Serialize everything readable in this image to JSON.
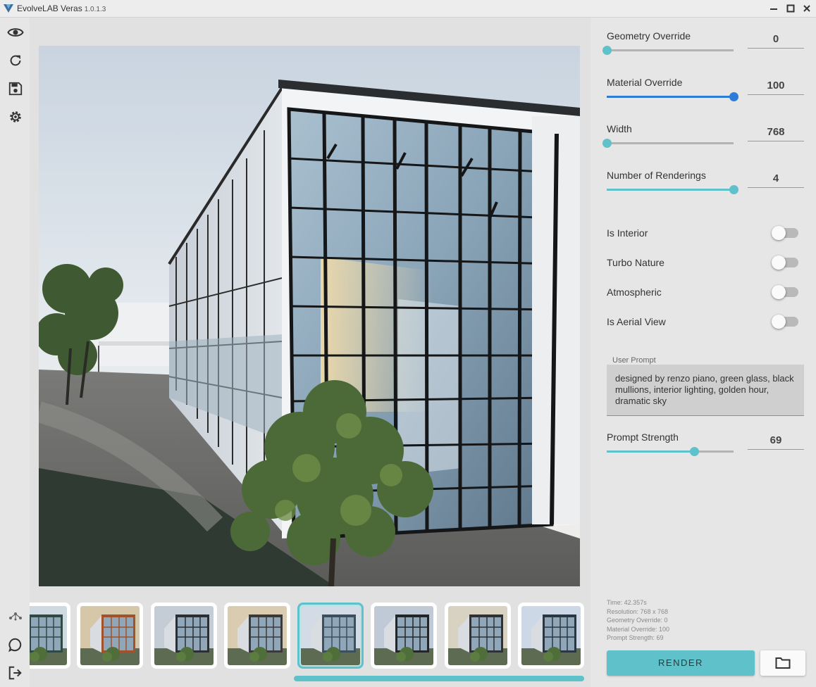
{
  "window": {
    "title": "EvolveLAB Veras",
    "version": "1.0.1.3"
  },
  "colors": {
    "accent": "#5fc1c9",
    "blue_slider": "#2f7bd8",
    "track": "#b3b3b3"
  },
  "sidebar": {
    "top_icons": [
      "eye-icon",
      "refresh-icon",
      "save-icon",
      "gear-icon"
    ],
    "bottom_icons": [
      "share-icon",
      "chat-icon",
      "logout-icon"
    ]
  },
  "sliders": [
    {
      "label": "Geometry Override",
      "value": "0",
      "fraction": 0.0,
      "color": "#5fc1c9"
    },
    {
      "label": "Material Override",
      "value": "100",
      "fraction": 1.0,
      "color": "#2f7bd8"
    },
    {
      "label": "Width",
      "value": "768",
      "fraction": 0.0,
      "color": "#5fc1c9"
    },
    {
      "label": "Number of Renderings",
      "value": "4",
      "fraction": 1.0,
      "color": "#5fc1c9"
    }
  ],
  "toggles": [
    {
      "label": "Is Interior",
      "on": false
    },
    {
      "label": "Turbo Nature",
      "on": false
    },
    {
      "label": "Atmospheric",
      "on": false
    },
    {
      "label": "Is Aerial View",
      "on": false
    }
  ],
  "prompt": {
    "caption": "User Prompt",
    "text": "designed by renzo piano, green glass, black mullions, interior lighting, golden hour, dramatic sky"
  },
  "prompt_strength": {
    "label": "Prompt Strength",
    "value": "69",
    "fraction": 0.69,
    "color": "#5fc1c9"
  },
  "stats": {
    "time": "Time: 42.357s",
    "resolution": "Resolution: 768 x 768",
    "geometry": "Geometry Override: 0",
    "material": "Material Override: 100",
    "strength": "Prompt Strength: 69"
  },
  "buttons": {
    "render": "RENDER",
    "folder_icon": "folder-icon"
  },
  "thumbnails": {
    "count": 8,
    "selected_index": 4
  }
}
